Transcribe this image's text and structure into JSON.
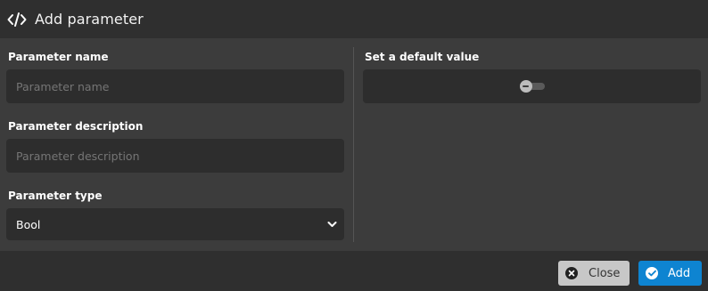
{
  "dialog": {
    "title": "Add parameter",
    "header_icon": "code-icon"
  },
  "form": {
    "name": {
      "label": "Parameter name",
      "placeholder": "Parameter name",
      "value": ""
    },
    "description": {
      "label": "Parameter description",
      "placeholder": "Parameter description",
      "value": ""
    },
    "type": {
      "label": "Parameter type",
      "selected": "Bool",
      "icon": "chevron-down-icon"
    },
    "default_value": {
      "label": "Set a default value",
      "toggle_state": "off"
    }
  },
  "footer": {
    "close_label": "Close",
    "close_icon": "close-circle-icon",
    "add_label": "Add",
    "add_icon": "check-circle-icon"
  },
  "colors": {
    "background": "#3c3c3c",
    "header": "#2f2f2f",
    "field": "#2d2d2d",
    "accent": "#0e84d1",
    "close_button": "#c7c7c7"
  }
}
